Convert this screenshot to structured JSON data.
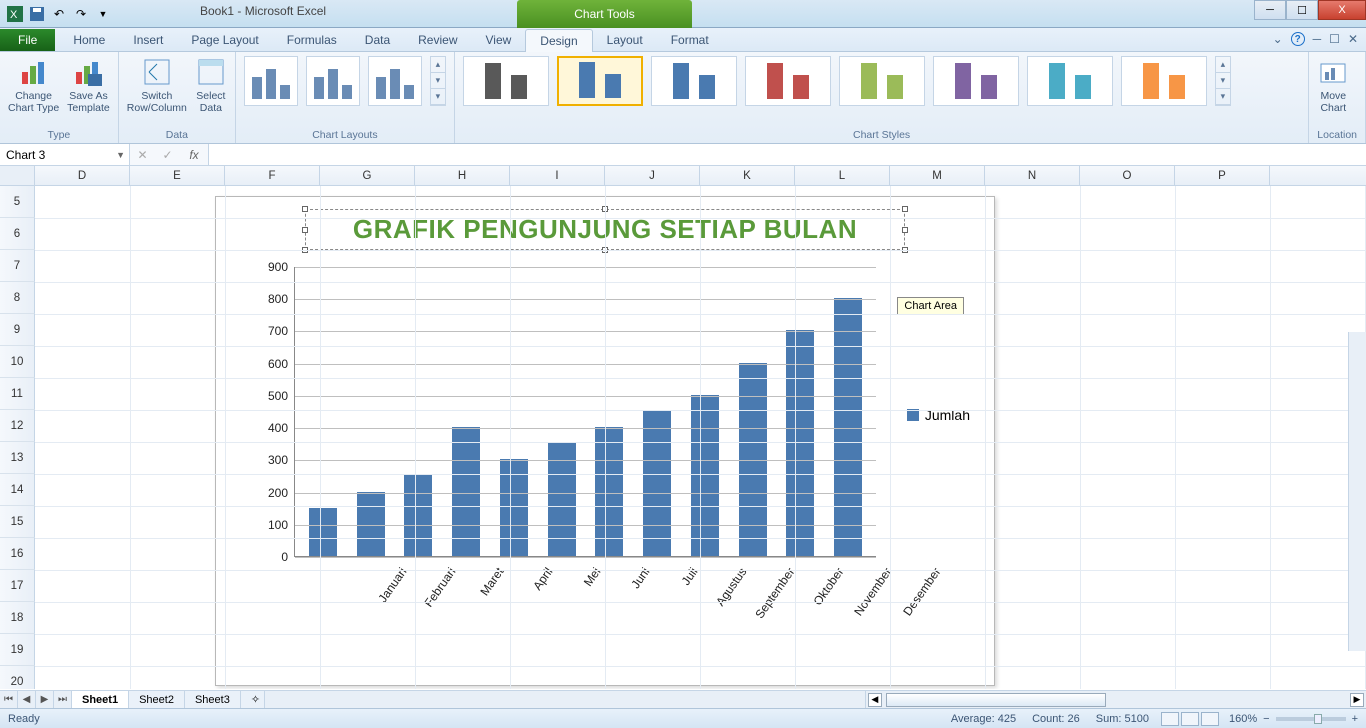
{
  "title_bar": {
    "doc_title": "Book1 - Microsoft Excel",
    "chart_tools": "Chart Tools"
  },
  "win": {
    "min": "─",
    "max": "☐",
    "close": "X"
  },
  "tabs": {
    "file": "File",
    "home": "Home",
    "insert": "Insert",
    "page_layout": "Page Layout",
    "formulas": "Formulas",
    "data": "Data",
    "review": "Review",
    "view": "View",
    "design": "Design",
    "layout": "Layout",
    "format": "Format"
  },
  "ribbon": {
    "type_group": "Type",
    "data_group": "Data",
    "layouts_group": "Chart Layouts",
    "styles_group": "Chart Styles",
    "location_group": "Location",
    "change_type": "Change\nChart Type",
    "save_template": "Save As\nTemplate",
    "switch": "Switch\nRow/Column",
    "select_data": "Select\nData",
    "move_chart": "Move\nChart"
  },
  "name_box": "Chart 3",
  "fx": "fx",
  "columns": [
    "D",
    "E",
    "F",
    "G",
    "H",
    "I",
    "J",
    "K",
    "L",
    "M",
    "N",
    "O",
    "P"
  ],
  "rows": [
    "5",
    "6",
    "7",
    "8",
    "9",
    "10",
    "11",
    "12",
    "13",
    "14",
    "15",
    "16",
    "17",
    "18",
    "19",
    "20"
  ],
  "chart_data": {
    "type": "bar",
    "title": "GRAFIK PENGUNJUNG SETIAP BULAN",
    "categories": [
      "Januari",
      "Februari",
      "Maret",
      "April",
      "Mei",
      "Juni",
      "Juli",
      "Agustus",
      "September",
      "Oktober",
      "November",
      "Desember"
    ],
    "series": [
      {
        "name": "Jumlah",
        "values": [
          150,
          200,
          250,
          400,
          300,
          350,
          400,
          450,
          500,
          600,
          700,
          800
        ]
      }
    ],
    "ylim": [
      0,
      900
    ],
    "y_ticks": [
      0,
      100,
      200,
      300,
      400,
      500,
      600,
      700,
      800,
      900
    ],
    "tooltip": "Chart Area"
  },
  "sheets": {
    "s1": "Sheet1",
    "s2": "Sheet2",
    "s3": "Sheet3"
  },
  "status": {
    "ready": "Ready",
    "average": "Average: 425",
    "count": "Count: 26",
    "sum": "Sum: 5100",
    "zoom": "160%"
  }
}
